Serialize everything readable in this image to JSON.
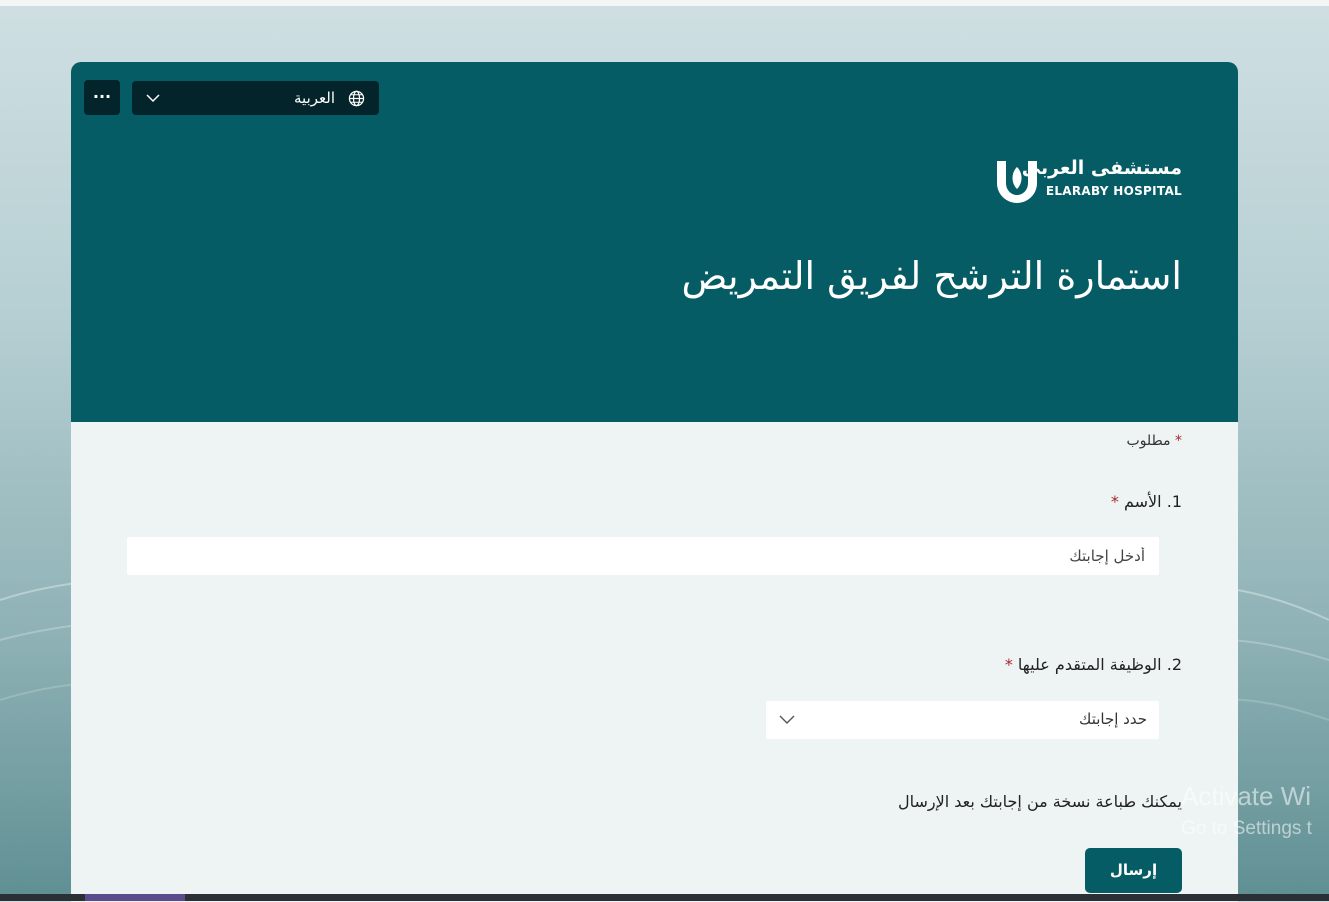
{
  "header": {
    "more_label": "···",
    "language_label": "العربية",
    "logo_arabic": "مستشفى العربى",
    "logo_english": "ELARABY HOSPITAL",
    "form_title": "استمارة الترشح لفريق التمريض"
  },
  "form": {
    "required_note": "مطلوب",
    "required_star": "*",
    "q1": {
      "number": "1.",
      "label": "الأسم",
      "placeholder": "أدخل إجابتك"
    },
    "q2": {
      "number": "2.",
      "label": "الوظيفة المتقدم عليها",
      "select_value": "حدد إجابتك"
    },
    "print_note": "يمكنك طباعة نسخة من إجابتك بعد الإرسال",
    "submit_label": "إرسال"
  },
  "overlay": {
    "activate_line1": "Activate Wi",
    "activate_line2": "Go to Settings t"
  },
  "colors": {
    "header_bg": "#065c65",
    "button_bg": "#065c65",
    "toolbar_bg": "#03242a",
    "required_star": "#a4262c"
  }
}
